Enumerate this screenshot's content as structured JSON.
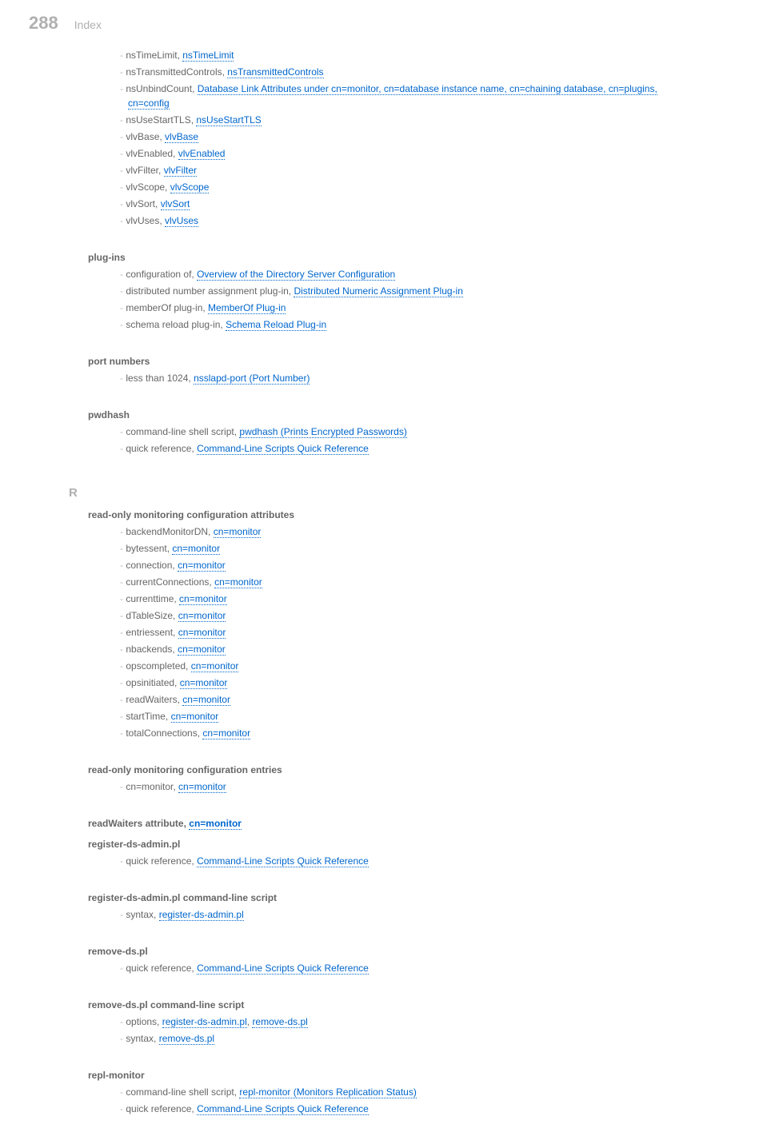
{
  "header": {
    "page_number": "288",
    "title": "Index"
  },
  "letter": "R",
  "top_items": [
    {
      "pre": "nsTimeLimit, ",
      "link": "nsTimeLimit"
    },
    {
      "pre": "nsTransmittedControls, ",
      "link": "nsTransmittedControls"
    },
    {
      "pre": "nsUnbindCount, ",
      "link": "Database Link Attributes under cn=monitor, cn=database instance name, cn=chaining database, cn=plugins, cn=config",
      "wrap": true
    },
    {
      "pre": "nsUseStartTLS, ",
      "link": "nsUseStartTLS"
    },
    {
      "pre": "vlvBase, ",
      "link": "vlvBase"
    },
    {
      "pre": "vlvEnabled, ",
      "link": "vlvEnabled"
    },
    {
      "pre": "vlvFilter, ",
      "link": "vlvFilter"
    },
    {
      "pre": "vlvScope, ",
      "link": "vlvScope"
    },
    {
      "pre": "vlvSort, ",
      "link": "vlvSort"
    },
    {
      "pre": "vlvUses, ",
      "link": "vlvUses"
    }
  ],
  "sections": [
    {
      "heading": "plug-ins",
      "items": [
        {
          "pre": "configuration of, ",
          "link": "Overview of the Directory Server Configuration"
        },
        {
          "pre": "distributed number assignment plug-in, ",
          "link": "Distributed Numeric Assignment Plug-in"
        },
        {
          "pre": "memberOf plug-in, ",
          "link": "MemberOf Plug-in"
        },
        {
          "pre": "schema reload plug-in, ",
          "link": "Schema Reload Plug-in"
        }
      ]
    },
    {
      "heading": "port numbers",
      "items": [
        {
          "pre": "less than 1024, ",
          "link": "nsslapd-port (Port Number)"
        }
      ]
    },
    {
      "heading": "pwdhash",
      "items": [
        {
          "pre": "command-line shell script, ",
          "link": "pwdhash (Prints Encrypted Passwords)"
        },
        {
          "pre": "quick reference, ",
          "link": "Command-Line Scripts Quick Reference"
        }
      ]
    }
  ],
  "r_sections": [
    {
      "heading": "read-only monitoring configuration attributes",
      "items": [
        {
          "pre": "backendMonitorDN, ",
          "link": "cn=monitor"
        },
        {
          "pre": "bytessent, ",
          "link": "cn=monitor"
        },
        {
          "pre": "connection, ",
          "link": "cn=monitor"
        },
        {
          "pre": "currentConnections, ",
          "link": "cn=monitor"
        },
        {
          "pre": "currenttime, ",
          "link": "cn=monitor"
        },
        {
          "pre": "dTableSize, ",
          "link": "cn=monitor"
        },
        {
          "pre": "entriessent, ",
          "link": "cn=monitor"
        },
        {
          "pre": "nbackends, ",
          "link": "cn=monitor"
        },
        {
          "pre": "opscompleted, ",
          "link": "cn=monitor"
        },
        {
          "pre": "opsinitiated, ",
          "link": "cn=monitor"
        },
        {
          "pre": "readWaiters, ",
          "link": "cn=monitor"
        },
        {
          "pre": "startTime, ",
          "link": "cn=monitor"
        },
        {
          "pre": "totalConnections, ",
          "link": "cn=monitor"
        }
      ]
    },
    {
      "heading": "read-only monitoring configuration entries",
      "items": [
        {
          "pre": "cn=monitor, ",
          "link": "cn=monitor"
        }
      ]
    },
    {
      "heading_inline_pre": "readWaiters attribute, ",
      "heading_inline_link": "cn=monitor"
    },
    {
      "heading": "register-ds-admin.pl",
      "items": [
        {
          "pre": "quick reference, ",
          "link": "Command-Line Scripts Quick Reference"
        }
      ]
    },
    {
      "heading": "register-ds-admin.pl command-line script",
      "items": [
        {
          "pre": "syntax, ",
          "link": "register-ds-admin.pl"
        }
      ]
    },
    {
      "heading": "remove-ds.pl",
      "items": [
        {
          "pre": "quick reference, ",
          "link": "Command-Line Scripts Quick Reference"
        }
      ]
    },
    {
      "heading": "remove-ds.pl command-line script",
      "items": [
        {
          "pre": "options, ",
          "link": "register-ds-admin.pl",
          "post": ", ",
          "link2": "remove-ds.pl"
        },
        {
          "pre": "syntax, ",
          "link": "remove-ds.pl"
        }
      ]
    },
    {
      "heading": "repl-monitor",
      "items": [
        {
          "pre": "command-line shell script, ",
          "link": "repl-monitor (Monitors Replication Status)"
        },
        {
          "pre": "quick reference, ",
          "link": "Command-Line Scripts Quick Reference"
        }
      ]
    }
  ]
}
